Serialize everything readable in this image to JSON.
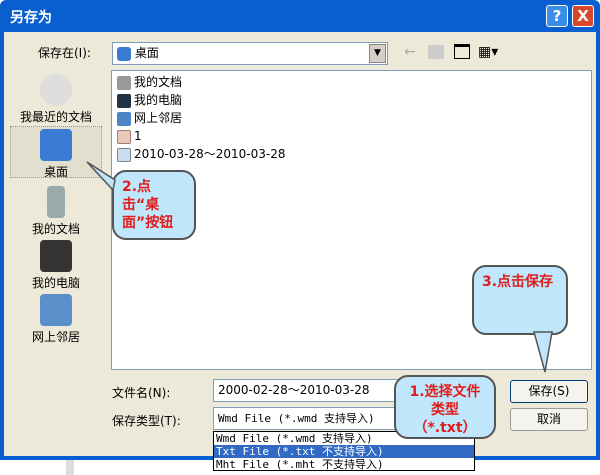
{
  "window": {
    "title": "另存为",
    "help": "?",
    "close": "X"
  },
  "save_in": {
    "label": "保存在(I):",
    "value": "桌面"
  },
  "places": [
    {
      "label": "我最近的文档"
    },
    {
      "label": "桌面"
    },
    {
      "label": "我的文档"
    },
    {
      "label": "我的电脑"
    },
    {
      "label": "网上邻居"
    }
  ],
  "files": [
    {
      "name": "我的文档"
    },
    {
      "name": "我的电脑"
    },
    {
      "name": "网上邻居"
    },
    {
      "name": "1"
    },
    {
      "name": "2010-03-28～2010-03-28"
    }
  ],
  "filename": {
    "label": "文件名(N):",
    "value": "2000-02-28～2010-03-28"
  },
  "filetype": {
    "label": "保存类型(T):",
    "value": "Wmd File (*.wmd 支持导入)",
    "options": [
      "Wmd File (*.wmd 支持导入)",
      "Txt File (*.txt 不支持导入)",
      "Mht File (*.mht 不支持导入)"
    ]
  },
  "buttons": {
    "save": "保存(S)",
    "cancel": "取消"
  },
  "callouts": {
    "step1": "1.选择文件类型（*.txt）",
    "step2": "2.点击“桌面”按钮",
    "step3": "3.点击保存"
  }
}
